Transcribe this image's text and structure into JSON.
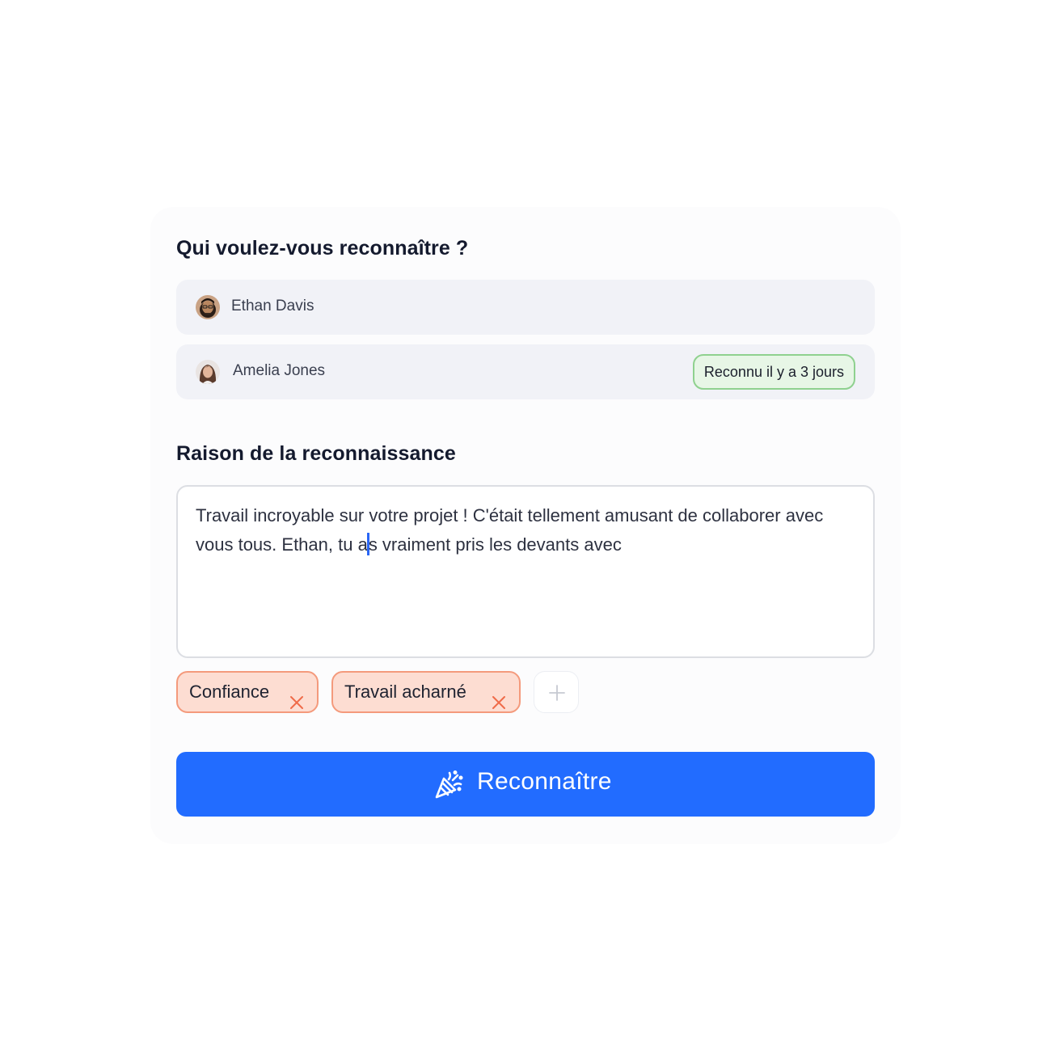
{
  "recognize_form": {
    "who_title": "Qui voulez-vous reconnaître ?",
    "recipients": [
      {
        "name": "Ethan Davis",
        "avatar_icon": "person-photo-icon"
      },
      {
        "name": "Amelia Jones",
        "avatar_icon": "person-photo-icon",
        "badge": "Reconnu il y a 3 jours"
      }
    ],
    "reason_title": "Raison de la reconnaissance",
    "reason": {
      "text_before_cursor": "Travail incroyable sur votre projet ! C'était tellement amusant de collaborer avec vous tous. Ethan, tu a",
      "text_after_cursor": "s vraiment pris les devants avec"
    },
    "tags": [
      {
        "label": "Confiance",
        "remove_icon": "close-icon"
      },
      {
        "label": "Travail acharné",
        "remove_icon": "close-icon"
      }
    ],
    "add_tag_icon": "plus-icon",
    "submit": {
      "label": "Reconnaître",
      "icon": "party-popper-icon"
    }
  },
  "colors": {
    "accent": "#226cff",
    "badge_green_bg": "#e7f6e6",
    "badge_green_border": "#8fd18f",
    "tag_bg": "#fdddd2",
    "tag_border": "#f49a7c",
    "tag_remove": "#ef6b49",
    "row_bg": "#f1f2f7"
  }
}
